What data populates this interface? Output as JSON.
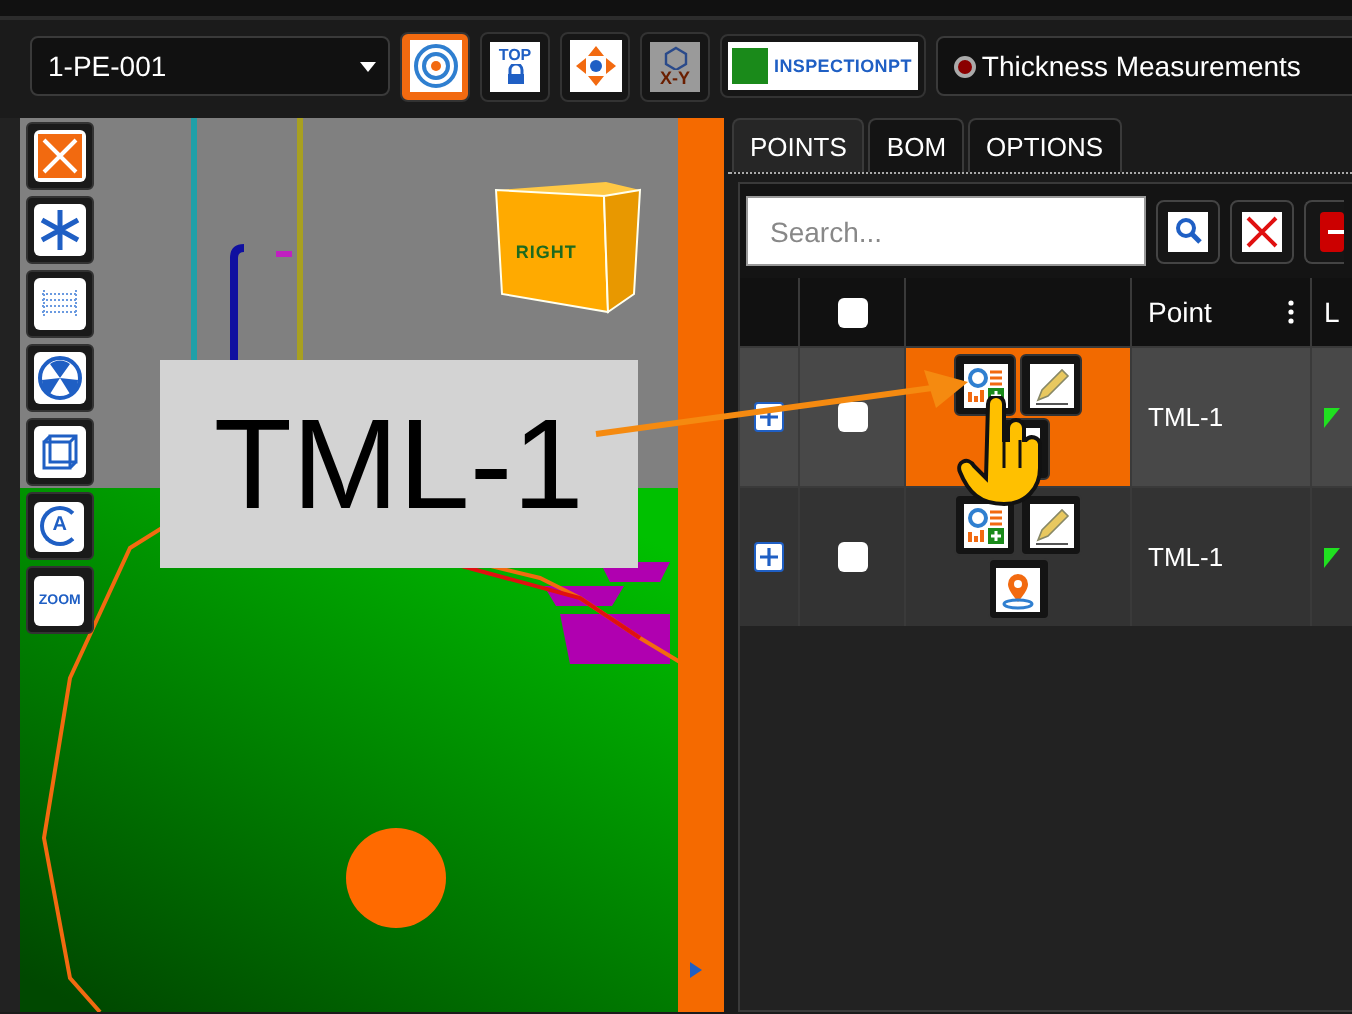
{
  "toolbar": {
    "model_select": "1-PE-001",
    "tools": [
      {
        "kind": "target",
        "active": true
      },
      {
        "kind": "top",
        "active": false,
        "label": "TOP"
      },
      {
        "kind": "move",
        "active": false
      },
      {
        "kind": "axis",
        "active": false,
        "label": "X-Y"
      }
    ],
    "inspection_button": "INSPECTIONPT",
    "measurement_select": "Thickness Measurements"
  },
  "side_tools": [
    {
      "kind": "fit"
    },
    {
      "kind": "freeze"
    },
    {
      "kind": "section"
    },
    {
      "kind": "radiation"
    },
    {
      "kind": "box"
    },
    {
      "kind": "rotate",
      "label": "A"
    },
    {
      "kind": "zoom",
      "label": "ZOOM"
    }
  ],
  "viewport": {
    "cube_label": "RIGHT",
    "callout": "TML-1"
  },
  "tabs": [
    {
      "label": "POINTS",
      "selected": true
    },
    {
      "label": "BOM",
      "selected": false
    },
    {
      "label": "OPTIONS",
      "selected": false
    }
  ],
  "search": {
    "placeholder": "Search..."
  },
  "table": {
    "select_all_checked": false,
    "columns": [
      "Point",
      "L"
    ],
    "rows": [
      {
        "point": "TML-1",
        "selected": true,
        "checked": false
      },
      {
        "point": "TML-1",
        "selected": false,
        "checked": false
      }
    ]
  }
}
